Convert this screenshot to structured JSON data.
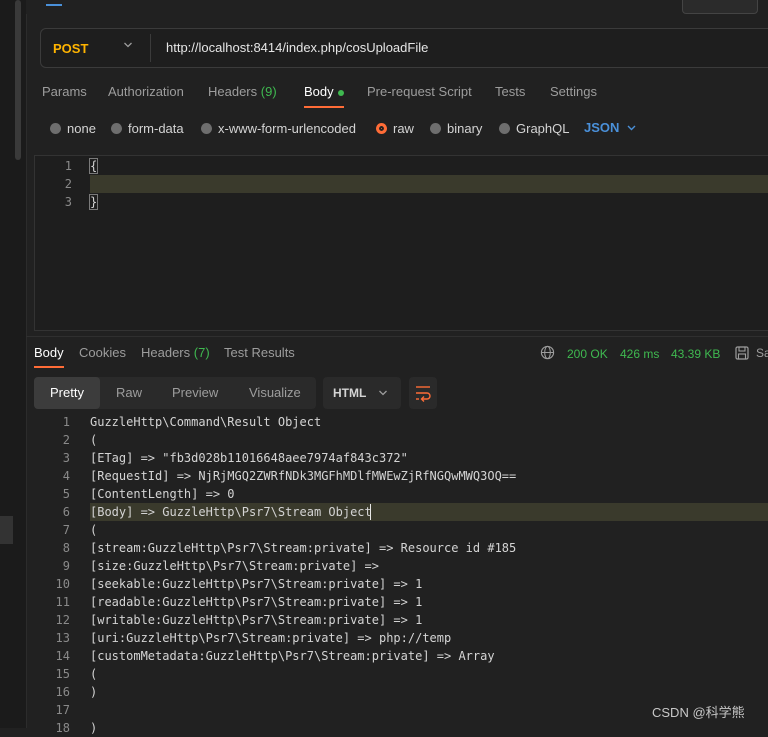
{
  "request": {
    "method": "POST",
    "url": "http://localhost:8414/index.php/cosUploadFile",
    "tabs": [
      {
        "label": "Params"
      },
      {
        "label": "Authorization"
      },
      {
        "label": "Headers",
        "count": "(9)"
      },
      {
        "label": "Body",
        "active": true
      },
      {
        "label": "Pre-request Script"
      },
      {
        "label": "Tests"
      },
      {
        "label": "Settings"
      }
    ],
    "body_types": [
      "none",
      "form-data",
      "x-www-form-urlencoded",
      "raw",
      "binary",
      "GraphQL"
    ],
    "selected_body_type": "raw",
    "format": "JSON",
    "editor": {
      "line_numbers": [
        "1",
        "2",
        "3"
      ],
      "lines": [
        "{",
        "",
        "}"
      ]
    }
  },
  "response": {
    "tabs": [
      {
        "label": "Body",
        "active": true
      },
      {
        "label": "Cookies"
      },
      {
        "label": "Headers",
        "count": "(7)"
      },
      {
        "label": "Test Results"
      }
    ],
    "status": "200 OK",
    "time": "426 ms",
    "size": "43.39 KB",
    "save_label": "Sa",
    "views": [
      "Pretty",
      "Raw",
      "Preview",
      "Visualize"
    ],
    "active_view": "Pretty",
    "language": "HTML",
    "line_numbers": [
      "1",
      "2",
      "3",
      "4",
      "5",
      "6",
      "7",
      "8",
      "9",
      "10",
      "11",
      "12",
      "13",
      "14",
      "15",
      "16",
      "17",
      "18"
    ],
    "lines": [
      "GuzzleHttp\\Command\\Result Object",
      "(",
      "[ETag] => \"fb3d028b11016648aee7974af843c372\"",
      "[RequestId] => NjRjMGQ2ZWRfNDk3MGFhMDlfMWEwZjRfNGQwMWQ3OQ==",
      "[ContentLength] => 0",
      "[Body] => GuzzleHttp\\Psr7\\Stream Object",
      "(",
      "[stream:GuzzleHttp\\Psr7\\Stream:private] => Resource id #185",
      "[size:GuzzleHttp\\Psr7\\Stream:private] =>",
      "[seekable:GuzzleHttp\\Psr7\\Stream:private] => 1",
      "[readable:GuzzleHttp\\Psr7\\Stream:private] => 1",
      "[writable:GuzzleHttp\\Psr7\\Stream:private] => 1",
      "[uri:GuzzleHttp\\Psr7\\Stream:private] => php://temp",
      "[customMetadata:GuzzleHttp\\Psr7\\Stream:private] => Array",
      "(",
      ")",
      "",
      ")"
    ]
  },
  "watermark": "CSDN @科学熊",
  "colors": {
    "accent": "#ff6c37",
    "method": "#ffb400",
    "success": "#3fb950",
    "link": "#4a90d9"
  }
}
